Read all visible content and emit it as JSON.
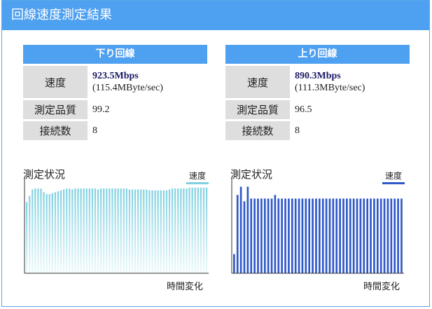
{
  "window": {
    "title": "回線速度測定結果"
  },
  "download": {
    "header": "下り回線",
    "speed_label": "速度",
    "speed_main": "923.5Mbps",
    "speed_sub": "(115.4MByte/sec)",
    "quality_label": "測定品質",
    "quality_value": "99.2",
    "connections_label": "接続数",
    "connections_value": "8"
  },
  "upload": {
    "header": "上り回線",
    "speed_label": "速度",
    "speed_main": "890.3Mbps",
    "speed_sub": "(111.3MByte/sec)",
    "quality_label": "測定品質",
    "quality_value": "96.5",
    "connections_label": "接続数",
    "connections_value": "8"
  },
  "colors": {
    "accent": "#4ea0f0",
    "download_series": "#7fd0e0",
    "upload_series": "#2f58c8"
  },
  "chart_data": [
    {
      "type": "bar",
      "title": "測定状況",
      "xlabel": "時間変化",
      "legend": "速度",
      "legend_position": "top-right",
      "ylim": [
        0,
        1
      ],
      "series": [
        {
          "name": "速度",
          "values": [
            0.78,
            0.85,
            0.92,
            0.93,
            0.93,
            0.93,
            0.89,
            0.87,
            0.87,
            0.88,
            0.89,
            0.9,
            0.91,
            0.92,
            0.93,
            0.93,
            0.92,
            0.93,
            0.93,
            0.93,
            0.93,
            0.93,
            0.93,
            0.93,
            0.93,
            0.92,
            0.93,
            0.93,
            0.93,
            0.93,
            0.93,
            0.93,
            0.93,
            0.93,
            0.93,
            0.93,
            0.92,
            0.92,
            0.92,
            0.92,
            0.92,
            0.92,
            0.92,
            0.91,
            0.91,
            0.91,
            0.91,
            0.91,
            0.91,
            0.91,
            0.92,
            0.93,
            0.93,
            0.93,
            0.93,
            0.93,
            0.93,
            0.94,
            0.94,
            0.94,
            0.94,
            0.94,
            0.94,
            0.94
          ]
        }
      ]
    },
    {
      "type": "bar",
      "title": "測定状況",
      "xlabel": "時間変化",
      "legend": "速度",
      "legend_position": "top-right",
      "ylim": [
        0,
        1
      ],
      "series": [
        {
          "name": "速度",
          "values": [
            0.21,
            0.86,
            0.95,
            0.79,
            0.95,
            0.82,
            0.82,
            0.82,
            0.82,
            0.82,
            0.82,
            0.82,
            0.86,
            0.82,
            0.82,
            0.82,
            0.82,
            0.82,
            0.82,
            0.82,
            0.82,
            0.82,
            0.82,
            0.82,
            0.82,
            0.82,
            0.82,
            0.82,
            0.82,
            0.82,
            0.82,
            0.82,
            0.82,
            0.82,
            0.82,
            0.82,
            0.82,
            0.82,
            0.82,
            0.82,
            0.82,
            0.82,
            0.82,
            0.82,
            0.82,
            0.82,
            0.82,
            0.82,
            0.82,
            0.82
          ]
        }
      ]
    }
  ]
}
